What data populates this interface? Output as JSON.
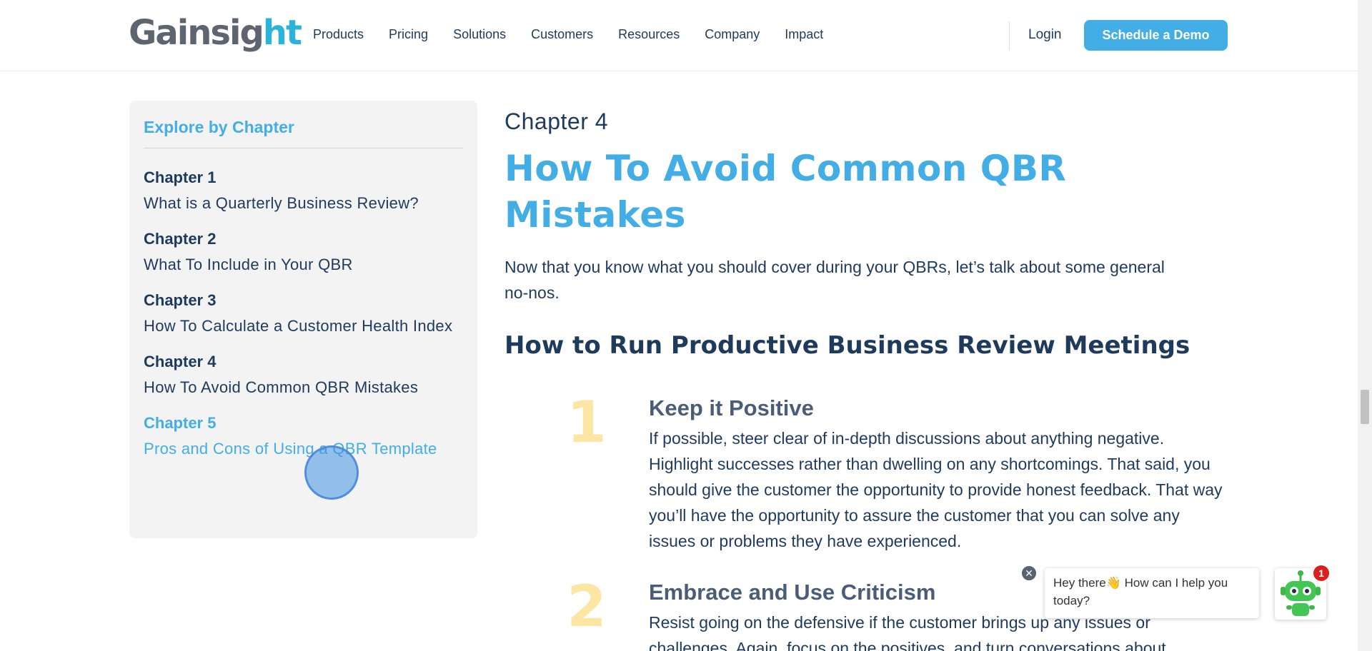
{
  "header": {
    "logo": {
      "text_main": "Gainsig",
      "text_accent": "ht"
    },
    "nav": [
      {
        "label": "Products"
      },
      {
        "label": "Pricing"
      },
      {
        "label": "Solutions"
      },
      {
        "label": "Customers"
      },
      {
        "label": "Resources"
      },
      {
        "label": "Company"
      },
      {
        "label": "Impact"
      }
    ],
    "login_label": "Login",
    "demo_label": "Schedule a Demo"
  },
  "sidebar": {
    "title": "Explore by Chapter",
    "chapters": [
      {
        "num": "Chapter 1",
        "title": "What is a Quarterly Business Review?"
      },
      {
        "num": "Chapter 2",
        "title": "What To Include in Your QBR"
      },
      {
        "num": "Chapter 3",
        "title": "How To Calculate a Customer Health Index"
      },
      {
        "num": "Chapter 4",
        "title": "How To Avoid Common QBR Mistakes"
      },
      {
        "num": "Chapter 5",
        "title": "Pros and Cons of Using a QBR Template"
      }
    ]
  },
  "main": {
    "eyebrow": "Chapter 4",
    "title": "How To Avoid Common QBR Mistakes",
    "intro": "Now that you know what you should cover during your QBRs, let’s talk about some general no-nos.",
    "section_title": "How to Run Productive Business Review Meetings",
    "steps": [
      {
        "num": "1",
        "heading": "Keep it Positive",
        "text": "If possible, steer clear of in-depth discussions about anything negative. Highlight successes rather than dwelling on any shortcomings. That said, you should give the customer the opportunity to provide honest feedback. That way you’ll have the opportunity to assure the customer that you can solve any issues or problems they have experienced."
      },
      {
        "num": "2",
        "heading": "Embrace and Use Criticism",
        "text": "Resist going on the defensive if the customer brings up any issues or challenges. Again, focus on the positives, and turn conversations about"
      }
    ]
  },
  "chat": {
    "greeting": "Hey there👋 How can I help you today?",
    "close_glyph": "✕",
    "badge_count": "1"
  },
  "colors": {
    "accent": "#43aee5",
    "navy": "#1e3a5c",
    "step_number": "#fde6a3",
    "sidebar_bg": "#f3f3f3"
  }
}
